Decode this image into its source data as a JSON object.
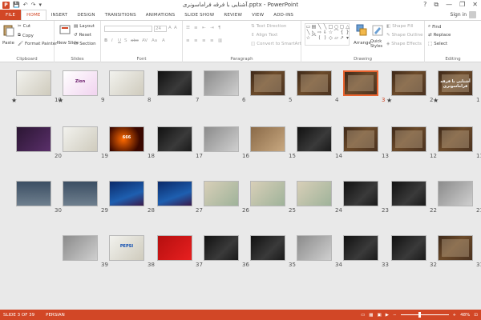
{
  "title_bar": {
    "logo": "P",
    "title": "آشنایی با فرقه فراماسونری.pptx - PowerPoint",
    "qat": [
      "💾",
      "↶",
      "↷",
      "▾"
    ],
    "controls": [
      "?",
      "⧉",
      "—",
      "❐",
      "✕"
    ]
  },
  "tabs": [
    "FILE",
    "HOME",
    "INSERT",
    "DESIGN",
    "TRANSITIONS",
    "ANIMATIONS",
    "SLIDE SHOW",
    "REVIEW",
    "VIEW",
    "ADD-INS"
  ],
  "active_tab": "HOME",
  "account": {
    "label": "Sign in"
  },
  "ribbon": {
    "clipboard": {
      "label": "Clipboard",
      "paste": "Paste",
      "cut": "Cut",
      "copy": "Copy",
      "format_painter": "Format Painter"
    },
    "slides": {
      "label": "Slides",
      "new_slide": "New Slide",
      "layout": "Layout",
      "reset": "Reset",
      "section": "Section"
    },
    "font": {
      "label": "Font",
      "size": "24"
    },
    "paragraph": {
      "label": "Paragraph",
      "text_direction": "Text Direction",
      "align_text": "Align Text",
      "convert_smartart": "Convert to SmartArt"
    },
    "drawing": {
      "label": "Drawing",
      "arrange": "Arrange",
      "quick_styles": "Quick Styles",
      "shape_fill": "Shape Fill",
      "shape_outline": "Shape Outline",
      "shape_effects": "Shape Effects"
    },
    "editing": {
      "label": "Editing",
      "find": "Find",
      "replace": "Replace",
      "select": "Select"
    }
  },
  "slides": [
    {
      "n": "1",
      "star": true,
      "style": "t-brown",
      "text": "آشنایی با فرقه فراماسونری"
    },
    {
      "n": "2",
      "star": true,
      "style": "t-brown",
      "text": ""
    },
    {
      "n": "3",
      "star": false,
      "style": "t-brown",
      "text": "",
      "selected": true
    },
    {
      "n": "4",
      "star": false,
      "style": "t-brown",
      "text": ""
    },
    {
      "n": "5",
      "star": false,
      "style": "t-brown",
      "text": ""
    },
    {
      "n": "6",
      "star": false,
      "style": "t-gray",
      "text": ""
    },
    {
      "n": "7",
      "star": false,
      "style": "t-dark",
      "text": ""
    },
    {
      "n": "8",
      "star": false,
      "style": "t-light",
      "text": ""
    },
    {
      "n": "9",
      "star": true,
      "style": "t-pink",
      "text": "Zion"
    },
    {
      "n": "10",
      "star": true,
      "style": "t-light",
      "text": ""
    },
    {
      "n": "11",
      "star": false,
      "style": "t-brown",
      "text": ""
    },
    {
      "n": "12",
      "star": false,
      "style": "t-brown",
      "text": ""
    },
    {
      "n": "13",
      "star": false,
      "style": "t-brown",
      "text": ""
    },
    {
      "n": "14",
      "star": false,
      "style": "t-dark",
      "text": ""
    },
    {
      "n": "15",
      "star": false,
      "style": "t-brownlight",
      "text": ""
    },
    {
      "n": "16",
      "star": false,
      "style": "t-gray",
      "text": ""
    },
    {
      "n": "17",
      "star": false,
      "style": "t-dark",
      "text": ""
    },
    {
      "n": "18",
      "star": false,
      "style": "t-orange",
      "text": "666"
    },
    {
      "n": "19",
      "star": false,
      "style": "t-light",
      "text": ""
    },
    {
      "n": "20",
      "star": false,
      "style": "t-purple",
      "text": ""
    },
    {
      "n": "21",
      "star": false,
      "style": "t-gray",
      "text": ""
    },
    {
      "n": "22",
      "star": false,
      "style": "t-dark",
      "text": ""
    },
    {
      "n": "23",
      "star": false,
      "style": "t-dark",
      "text": ""
    },
    {
      "n": "24",
      "star": false,
      "style": "t-map",
      "text": ""
    },
    {
      "n": "25",
      "star": false,
      "style": "t-map",
      "text": ""
    },
    {
      "n": "26",
      "star": false,
      "style": "t-map",
      "text": ""
    },
    {
      "n": "27",
      "star": false,
      "style": "t-blue",
      "text": ""
    },
    {
      "n": "28",
      "star": false,
      "style": "t-blue",
      "text": ""
    },
    {
      "n": "29",
      "star": false,
      "style": "t-sky",
      "text": ""
    },
    {
      "n": "30",
      "star": false,
      "style": "t-sky",
      "text": ""
    },
    {
      "n": "31",
      "star": false,
      "style": "t-brown",
      "text": ""
    },
    {
      "n": "32",
      "star": false,
      "style": "t-dark",
      "text": ""
    },
    {
      "n": "33",
      "star": false,
      "style": "t-dark",
      "text": ""
    },
    {
      "n": "34",
      "star": false,
      "style": "t-gray",
      "text": ""
    },
    {
      "n": "35",
      "star": false,
      "style": "t-dark",
      "text": ""
    },
    {
      "n": "36",
      "star": false,
      "style": "t-dark",
      "text": ""
    },
    {
      "n": "37",
      "star": false,
      "style": "t-red",
      "text": ""
    },
    {
      "n": "38",
      "star": false,
      "style": "t-light",
      "text": "PEPSI"
    },
    {
      "n": "39",
      "star": false,
      "style": "t-gray",
      "text": ""
    }
  ],
  "status": {
    "slide_info": "SLIDE 3 OF 39",
    "language": "PERSIAN",
    "zoom": "48%"
  },
  "colors": {
    "accent": "#d24726",
    "selection": "#e8632f",
    "sorter_bg": "#e9e9e9"
  }
}
